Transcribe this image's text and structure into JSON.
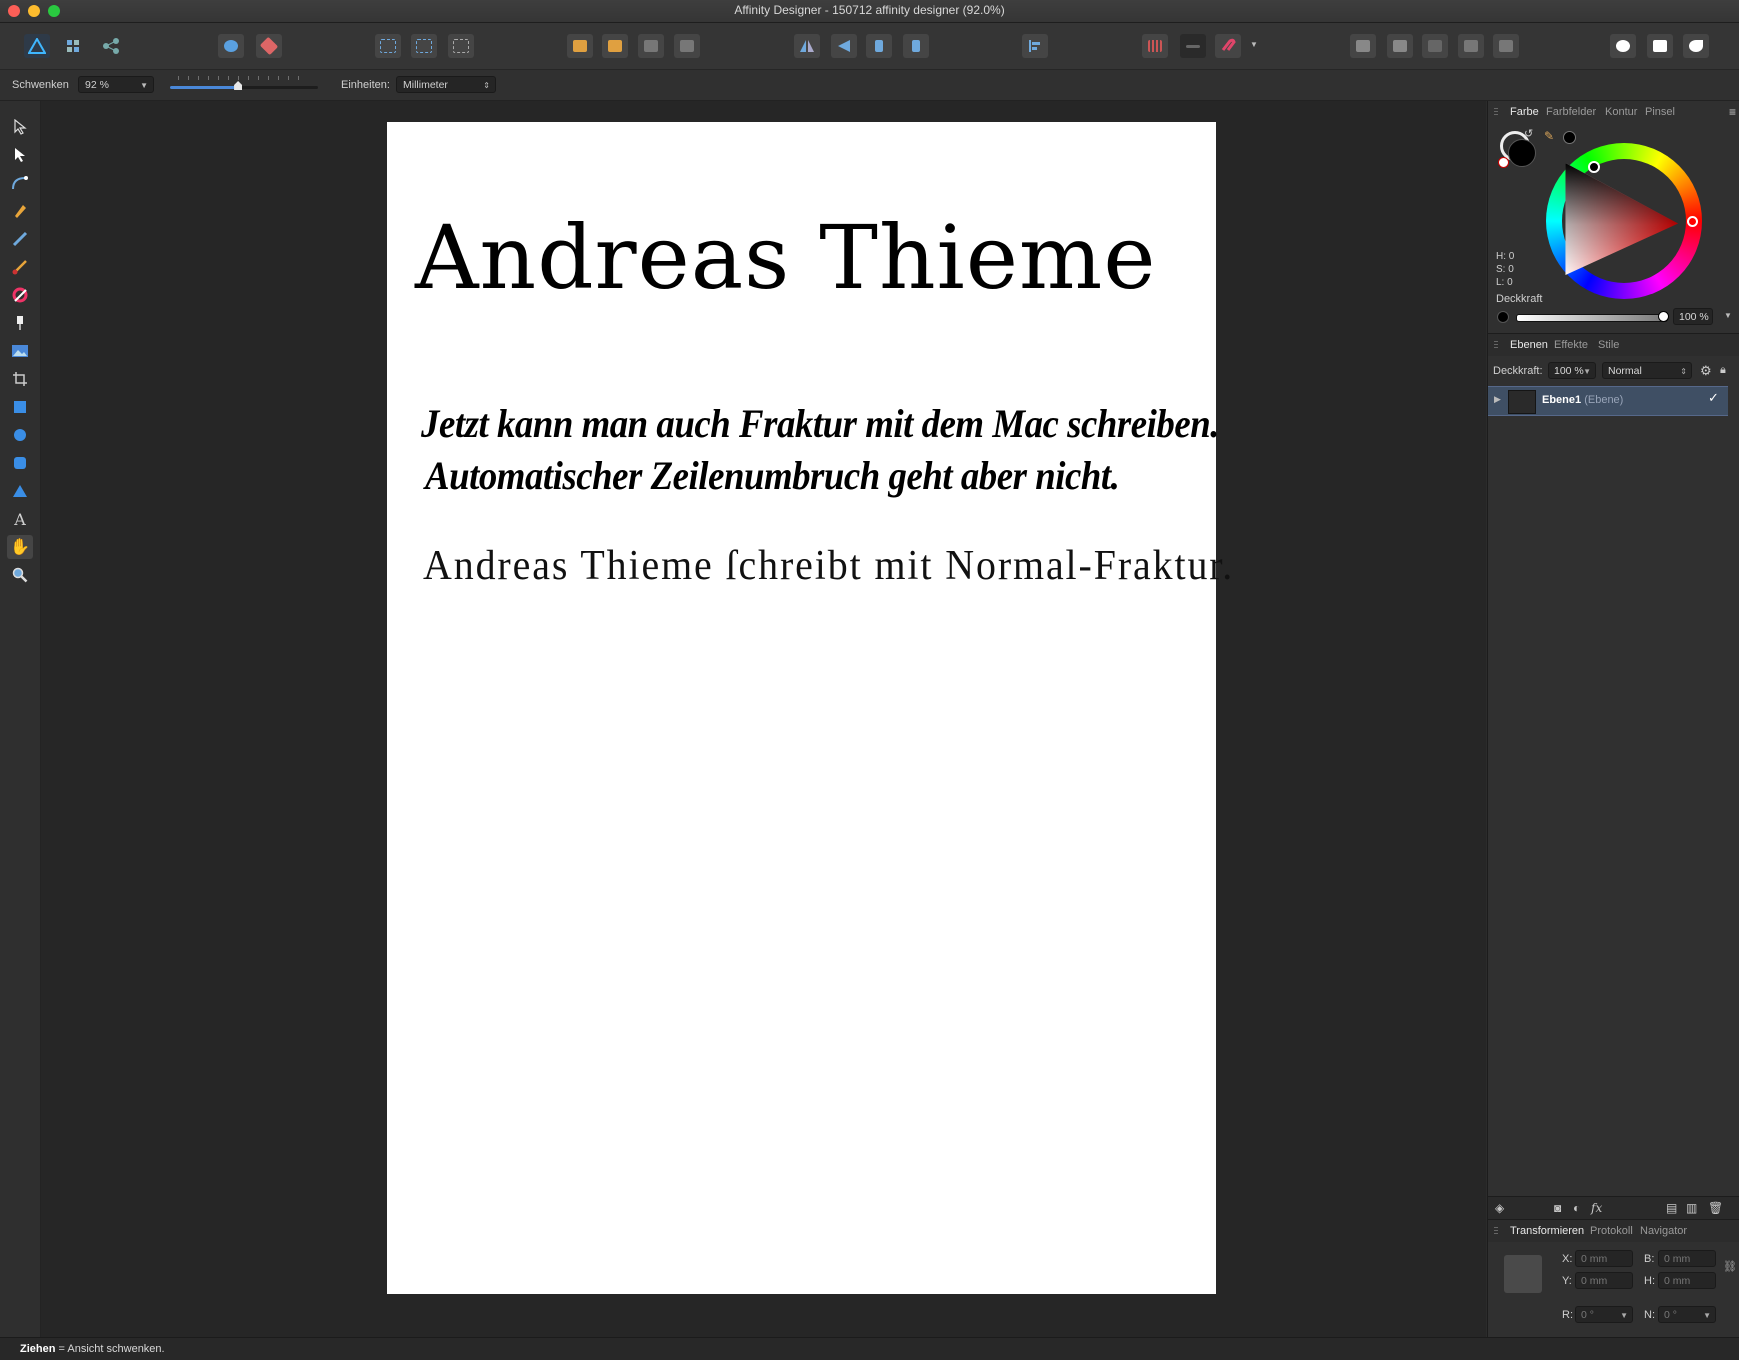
{
  "window": {
    "title": "Affinity Designer - 150712 affinity designer (92.0%)"
  },
  "context_bar": {
    "tool_name": "Schwenken",
    "zoom_value": "92 %",
    "zoom_fraction": 0.46,
    "units_label": "Einheiten:",
    "units_value": "Millimeter"
  },
  "document": {
    "title": "Andreas Thieme",
    "fraktur_line1": "Jetzt kann man auch Fraktur mit dem Mac schreiben.",
    "fraktur_line2": "Automatischer Zeilenumbruch geht aber nicht.",
    "normal_fraktur": "Andreas Thieme ſchreibt mit Normal-Fraktur."
  },
  "color_panel": {
    "tabs": [
      "Farbe",
      "Farbfelder",
      "Kontur",
      "Pinsel"
    ],
    "h": "H: 0",
    "s": "S: 0",
    "l": "L: 0",
    "opacity_label": "Deckkraft",
    "opacity_value": "100 %"
  },
  "layers_panel": {
    "tabs": [
      "Ebenen",
      "Effekte",
      "Stile"
    ],
    "opacity_label": "Deckkraft:",
    "opacity_value": "100 %",
    "blend_mode": "Normal",
    "layer_name": "Ebene1",
    "layer_type": "(Ebene)"
  },
  "transform_panel": {
    "tabs": [
      "Transformieren",
      "Protokoll",
      "Navigator"
    ],
    "x_label": "X:",
    "x_value": "0 mm",
    "y_label": "Y:",
    "y_value": "0 mm",
    "b_label": "B:",
    "b_value": "0 mm",
    "h_label": "H:",
    "h_value": "0 mm",
    "r_label": "R:",
    "r_value": "0 °",
    "n_label": "N:",
    "n_value": "0 °"
  },
  "status": {
    "action": "Ziehen",
    "text": " = Ansicht schwenken."
  },
  "colors": {
    "accent": "#4a88d8",
    "layer_selected": "#3f4f64",
    "canvas_bg": "#262626",
    "page": "#ffffff"
  }
}
